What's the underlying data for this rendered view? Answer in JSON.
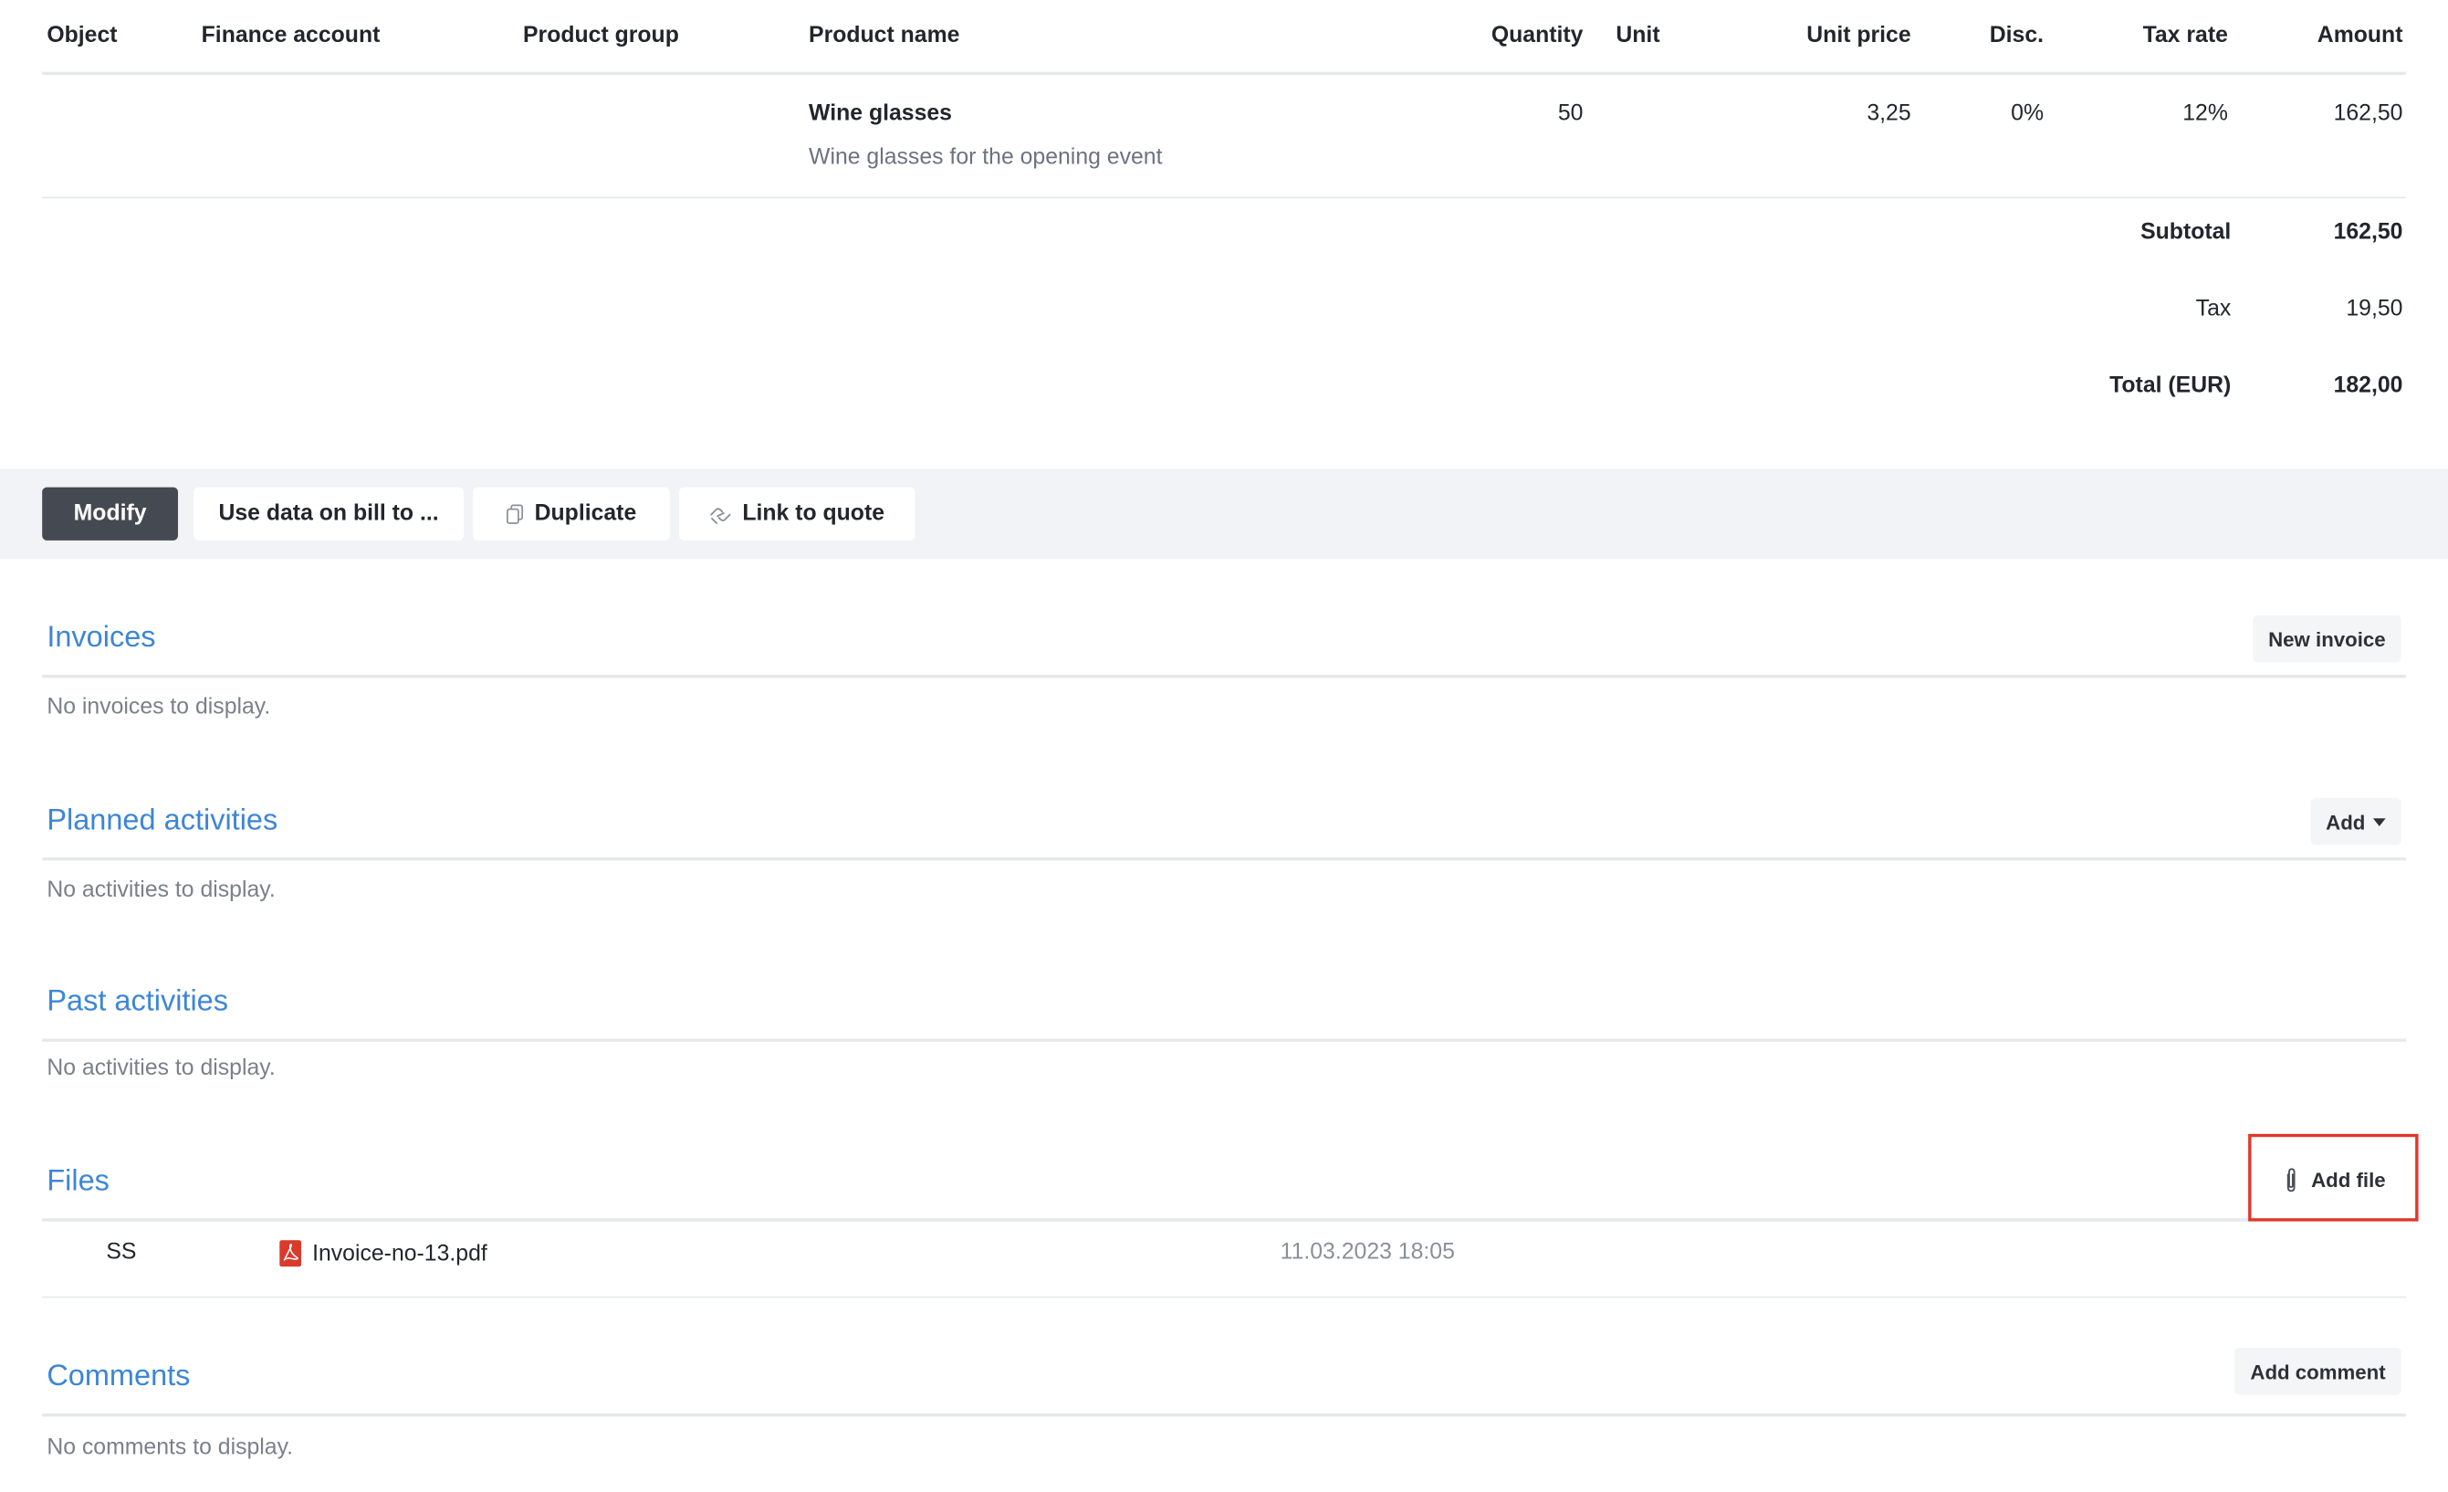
{
  "table": {
    "headers": {
      "object": "Object",
      "finance_account": "Finance account",
      "product_group": "Product group",
      "product_name": "Product name",
      "quantity": "Quantity",
      "unit": "Unit",
      "unit_price": "Unit price",
      "disc": "Disc.",
      "tax_rate": "Tax rate",
      "amount": "Amount"
    },
    "rows": [
      {
        "object": "",
        "finance_account": "",
        "product_group": "",
        "product_name": "Wine glasses",
        "description": "Wine glasses for the opening event",
        "quantity": "50",
        "unit": "",
        "unit_price": "3,25",
        "disc": "0%",
        "tax_rate": "12%",
        "amount": "162,50"
      }
    ]
  },
  "totals": {
    "subtotal_label": "Subtotal",
    "subtotal_value": "162,50",
    "tax_label": "Tax",
    "tax_value": "19,50",
    "total_label": "Total (EUR)",
    "total_value": "182,00"
  },
  "actions": {
    "modify": "Modify",
    "use_data": "Use data on bill to ...",
    "duplicate": "Duplicate",
    "link_to_quote": "Link to quote"
  },
  "sections": {
    "invoices": {
      "title": "Invoices",
      "button": "New invoice",
      "empty": "No invoices to display."
    },
    "planned": {
      "title": "Planned activities",
      "button": "Add",
      "empty": "No activities to display."
    },
    "past": {
      "title": "Past activities",
      "empty": "No activities to display."
    },
    "files": {
      "title": "Files",
      "button": "Add file",
      "items": [
        {
          "user": "SS",
          "filename": "Invoice-no-13.pdf",
          "date": "11.03.2023 18:05",
          "icon": "pdf-icon"
        }
      ]
    },
    "comments": {
      "title": "Comments",
      "button": "Add comment",
      "empty": "No comments to display."
    }
  },
  "colors": {
    "section_title": "#3d86d6",
    "highlight": "#e0382b",
    "action_bar_bg": "#f1f3f7",
    "primary_button": "#454a52",
    "pdf_icon": "#d93a2b"
  }
}
